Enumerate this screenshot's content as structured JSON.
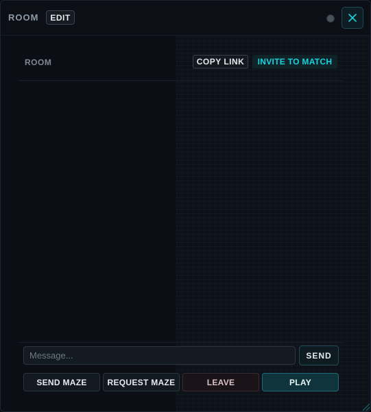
{
  "header": {
    "title": "ROOM",
    "edit_label": "EDIT",
    "status_icon": "status-dot-icon",
    "close_icon": "close-icon"
  },
  "room_bar": {
    "label": "ROOM",
    "copy_link_label": "COPY LINK",
    "invite_label": "INVITE TO MATCH"
  },
  "compose": {
    "placeholder": "Message...",
    "value": "",
    "send_label": "SEND"
  },
  "actions": {
    "send_maze": "SEND MAZE",
    "request_maze": "REQUEST MAZE",
    "leave": "LEAVE",
    "play": "PLAY"
  },
  "colors": {
    "accent": "#19d3e0",
    "background": "#0b0f15",
    "play": "#10343b",
    "leave": "#1a1317"
  }
}
